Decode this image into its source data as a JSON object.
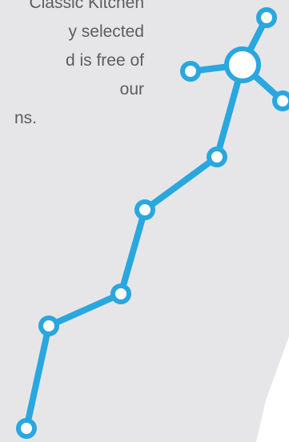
{
  "description_text": {
    "lines": [
      "Classic Kitchen",
      "y selected",
      "d is free of",
      "our",
      "ns."
    ]
  },
  "colors": {
    "background": "#e6e6e8",
    "panel": "#ffffff",
    "text": "#5d5d5d",
    "network": "#29a7df",
    "node_fill": "#ffffff"
  },
  "icons": {
    "network_graphic": "network-line-icon"
  }
}
